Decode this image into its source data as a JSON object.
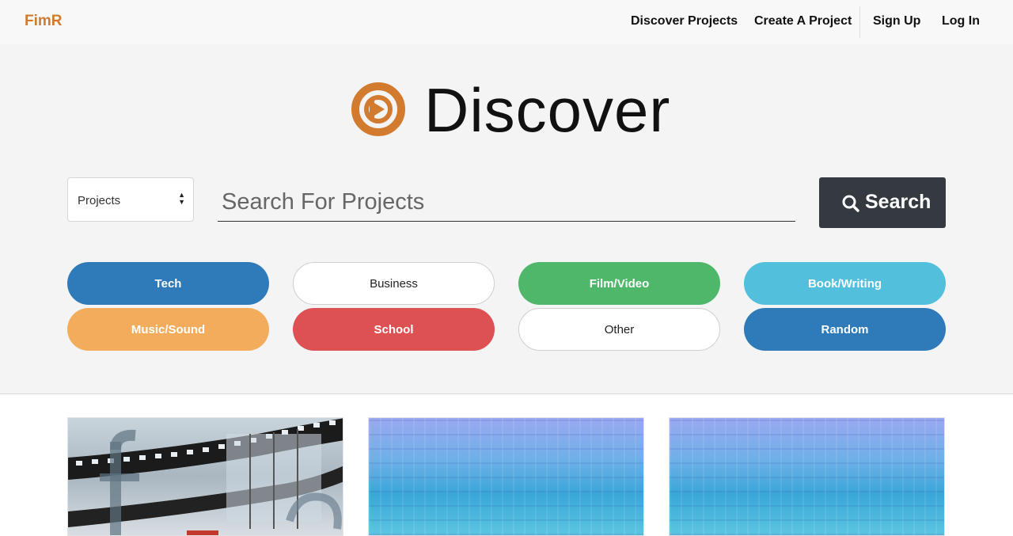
{
  "navbar": {
    "brand": "FimR",
    "links": [
      "Discover Projects",
      "Create A Project",
      "Sign Up",
      "Log In"
    ]
  },
  "hero": {
    "title": "Discover",
    "logo_icon": "play-circle-logo-icon",
    "accent_color": "#d27a2e"
  },
  "search": {
    "type_select": "Projects",
    "placeholder": "Search For Projects",
    "button_label": "Search"
  },
  "categories": [
    {
      "label": "Tech",
      "color": "#2f7ab8"
    },
    {
      "label": "Business",
      "color": "#ffffff"
    },
    {
      "label": "Film/Video",
      "color": "#4fb76a"
    },
    {
      "label": "Book/Writing",
      "color": "#52bfdc"
    },
    {
      "label": "Music/Sound",
      "color": "#f3ac5c"
    },
    {
      "label": "School",
      "color": "#de5153"
    },
    {
      "label": "Other",
      "color": "#ffffff"
    },
    {
      "label": "Random",
      "color": "#2f7ab8"
    }
  ],
  "cards": [
    {
      "image": "film-strip-image"
    },
    {
      "image": "circuit-board-image"
    },
    {
      "image": "circuit-board-image"
    }
  ]
}
